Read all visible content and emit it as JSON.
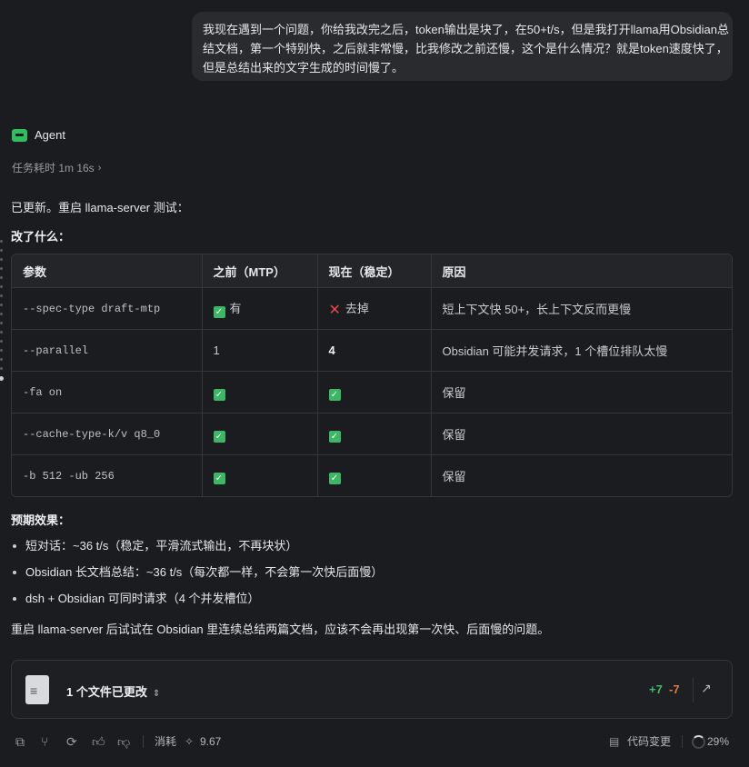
{
  "user_message": {
    "lines": [
      "我现在遇到一个问题，你给我改完之后，token输出是块了，在50+t/s，但是我打开llama用Obsidian总",
      "结文档，第一个特别快，之后就非常慢，比我修改之前还慢，这个是什么情况？就是token速度快了，",
      "但是总结出来的文字生成的时间慢了。"
    ]
  },
  "agent": {
    "name": "Agent",
    "duration": "任务耗时 1m 16s",
    "intro": "已更新。重启 llama-server 测试：",
    "changes_heading": "改了什么：",
    "table": {
      "headers": [
        "参数",
        "之前（MTP）",
        "现在（稳定）",
        "原因"
      ],
      "rows": [
        {
          "param": "--spec-type draft-mtp",
          "before": "有",
          "now": "去掉",
          "reason": "短上下文快 50+，长上下文反而更慢"
        },
        {
          "param": "--parallel",
          "before": "1",
          "now": "4",
          "reason": "Obsidian 可能并发请求，1 个槽位排队太慢"
        },
        {
          "param": "-fa on",
          "before": "",
          "now": "",
          "reason": "保留"
        },
        {
          "param": "--cache-type-k/v q8_0",
          "before": "",
          "now": "",
          "reason": "保留"
        },
        {
          "param": "-b 512 -ub 256",
          "before": "",
          "now": "",
          "reason": "保留"
        }
      ]
    },
    "effects_heading": "预期效果：",
    "effects": [
      "短对话：~36 t/s（稳定，平滑流式输出，不再块状）",
      "Obsidian 长文档总结：~36 t/s（每次都一样，不会第一次快后面慢）",
      "dsh + Obsidian 可同时请求（4 个并发槽位）"
    ],
    "closing": "重启 llama-server 后试试在 Obsidian 里连续总结两篇文档，应该不会再出现第一次快、后面慢的问题。"
  },
  "file_card": {
    "label": "1 个文件已更改",
    "additions": "+7",
    "deletions": "-7"
  },
  "footer": {
    "cost_label": "消耗",
    "cost_value": "9.67",
    "code_changes_label": "代码变更",
    "context_percent": "29%"
  },
  "colors": {
    "background": "#1b1c1f",
    "check_green": "#3bb765",
    "cross_red": "#e5484d",
    "additions": "#3fb96a",
    "deletions": "#e07a3f"
  }
}
